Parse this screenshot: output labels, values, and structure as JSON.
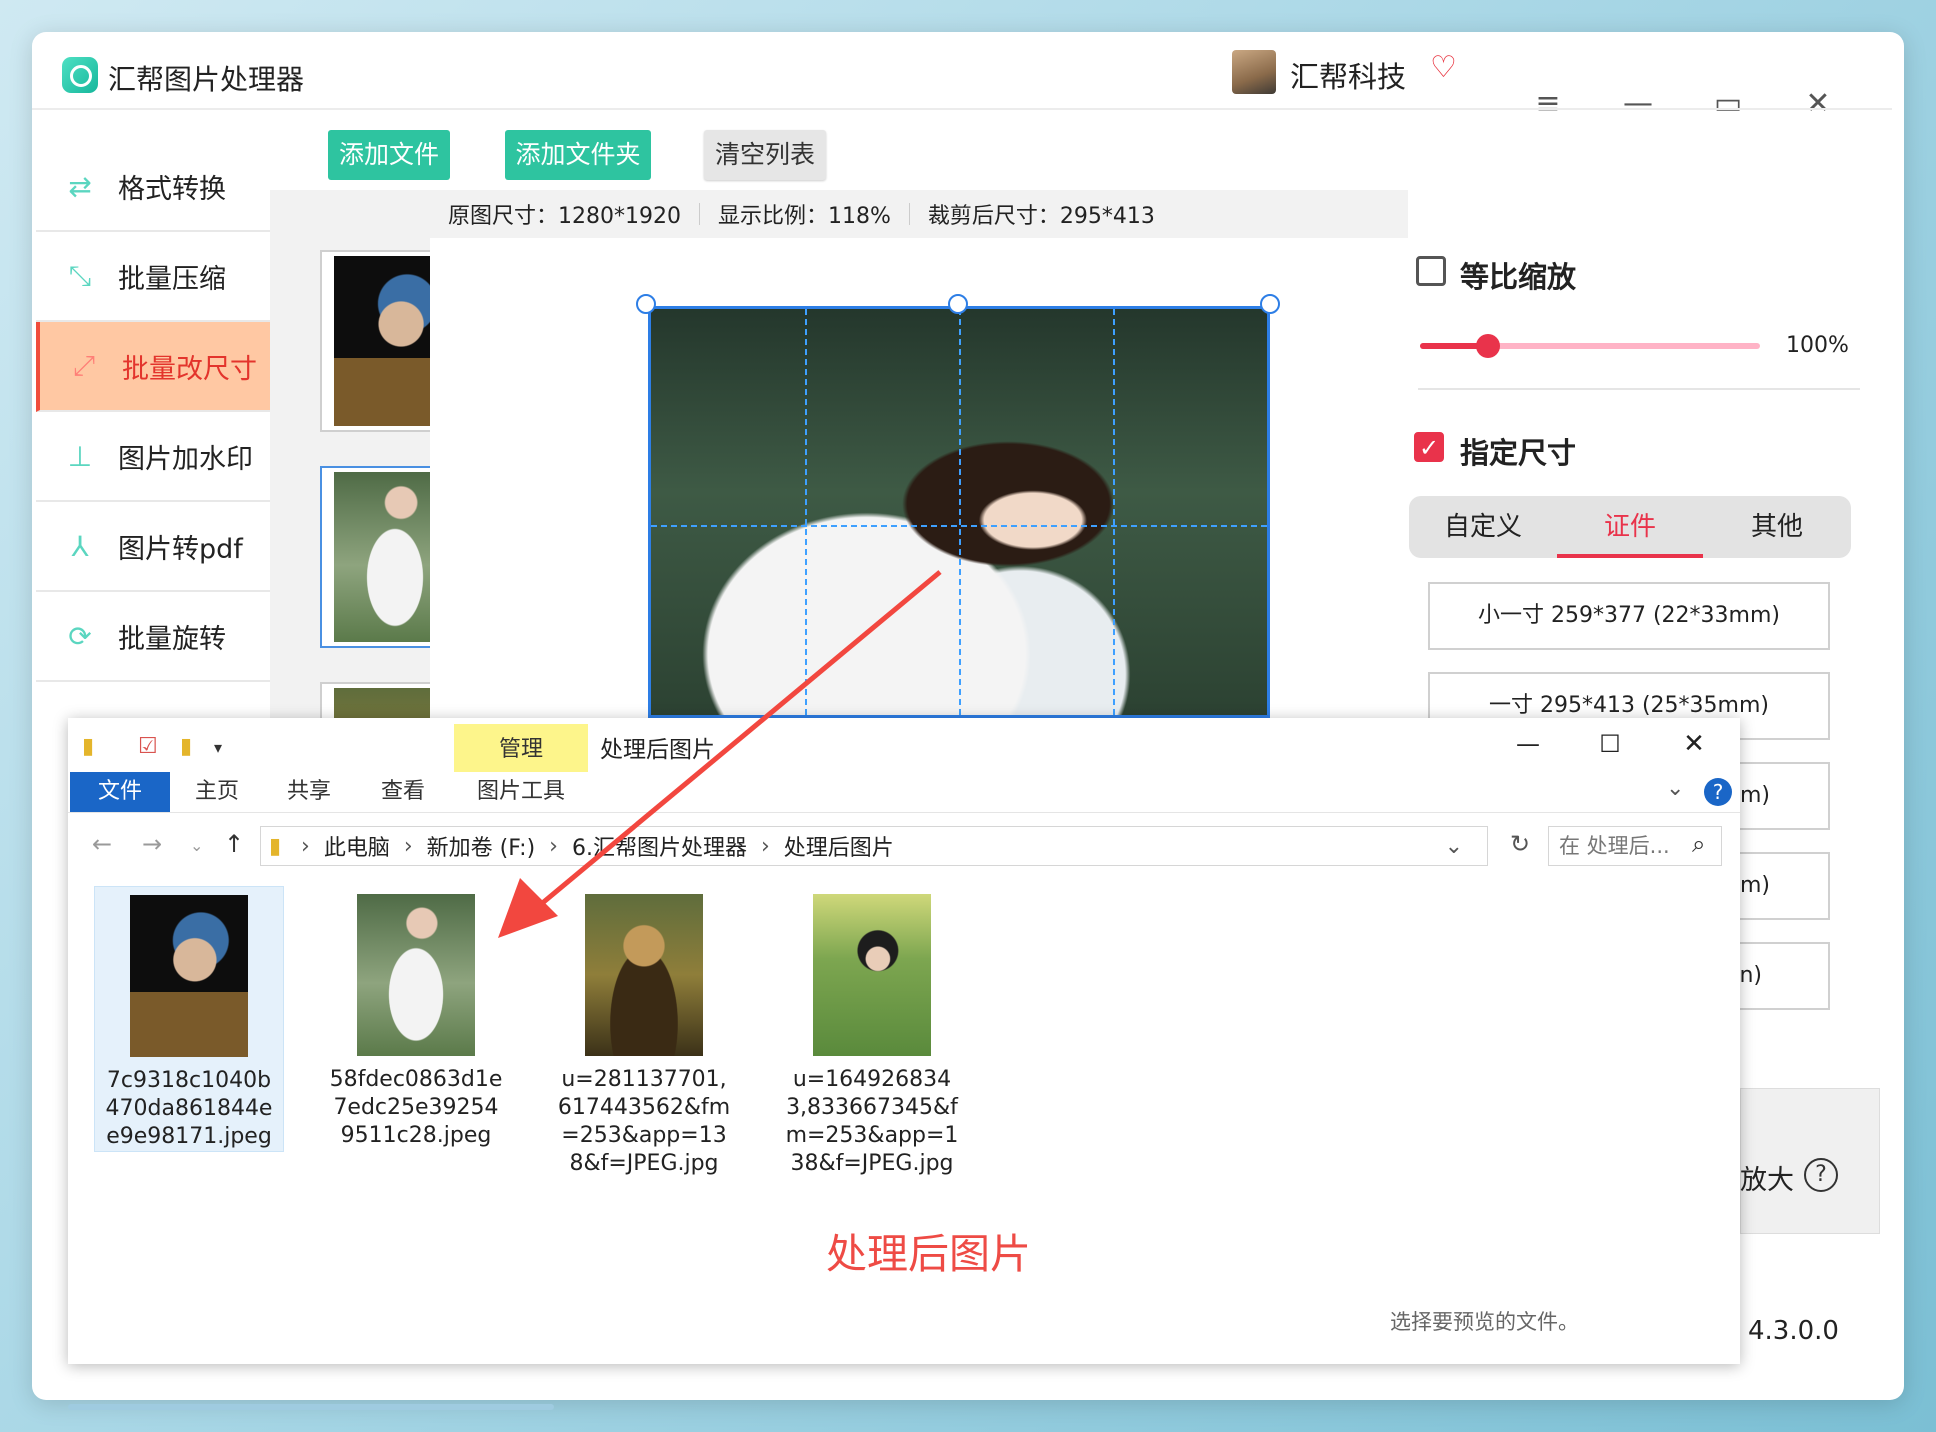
{
  "app": {
    "title": "汇帮图片处理器",
    "user_name": "汇帮科技",
    "version": "4.3.0.0"
  },
  "sidebar": {
    "items": [
      {
        "label": "格式转换",
        "icon": "format-convert-icon"
      },
      {
        "label": "批量压缩",
        "icon": "compress-icon"
      },
      {
        "label": "批量改尺寸",
        "icon": "resize-icon",
        "active": true
      },
      {
        "label": "图片加水印",
        "icon": "watermark-icon"
      },
      {
        "label": "图片转pdf",
        "icon": "pdf-icon"
      },
      {
        "label": "批量旋转",
        "icon": "rotate-icon"
      }
    ]
  },
  "toolbar": {
    "add_file": "添加文件",
    "add_folder": "添加文件夹",
    "clear_list": "清空列表"
  },
  "info": {
    "original_size": "原图尺寸：1280*1920",
    "display_ratio": "显示比例：118%",
    "cropped_size": "裁剪后尺寸：295*413"
  },
  "right_panel": {
    "proportional_label": "等比缩放",
    "proportional_checked": false,
    "scale_value": "100%",
    "scale_fraction": 0.2,
    "specify_size_label": "指定尺寸",
    "specify_size_checked": true,
    "tabs": [
      "自定义",
      "证件",
      "其他"
    ],
    "active_tab": "证件",
    "sizes": [
      "小一寸 259*377 (22*33mm)",
      "一寸 295*413 (25*35mm)",
      "m)",
      "m)",
      "n)"
    ],
    "zoom_label": "放大"
  },
  "explorer": {
    "title": "处理后图片",
    "manage_tab": "管理",
    "ribbon_tabs": [
      "文件",
      "主页",
      "共享",
      "查看",
      "图片工具"
    ],
    "breadcrumb": [
      "此电脑",
      "新加卷 (F:)",
      "6.汇帮图片处理器",
      "处理后图片"
    ],
    "search_placeholder": "在 处理后...",
    "files": [
      "7c9318c1040b470da861844ee9e98171.jpeg",
      "58fdec0863d1e7edc25e392549511c28.jpeg",
      "u=281137701,617443562&fm=253&app=138&f=JPEG.jpg",
      "u=1649268343,833667345&fm=253&app=138&f=JPEG.jpg"
    ],
    "note": "处理后图片",
    "preview_hint": "选择要预览的文件。"
  },
  "colors": {
    "accent_green": "#2ec4a0",
    "accent_red": "#e9334b",
    "active_sidebar_bg": "#ffc8a3",
    "explorer_blue": "#1a66c7"
  }
}
